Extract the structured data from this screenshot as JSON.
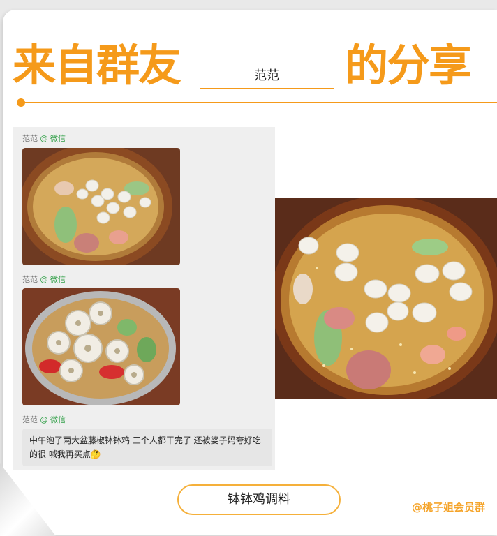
{
  "header": {
    "title_left": "来自群友",
    "name": "范范",
    "title_right": "的分享"
  },
  "chat": {
    "messages": [
      {
        "sender": "范范",
        "source": "@ 微信"
      },
      {
        "sender": "范范",
        "source": "@ 微信"
      },
      {
        "sender": "范范",
        "source": "@ 微信"
      }
    ],
    "text": "中午泡了两大盆藤椒钵钵鸡 三个人都干完了 还被婆子妈夸好吃的很 喊我再买点",
    "emoji": "🤔"
  },
  "cta": {
    "label": "钵钵鸡调料"
  },
  "footer": {
    "tag": "@桃子姐会员群"
  },
  "colors": {
    "accent": "#f59a1a",
    "wechat_green": "#2e9e45"
  }
}
